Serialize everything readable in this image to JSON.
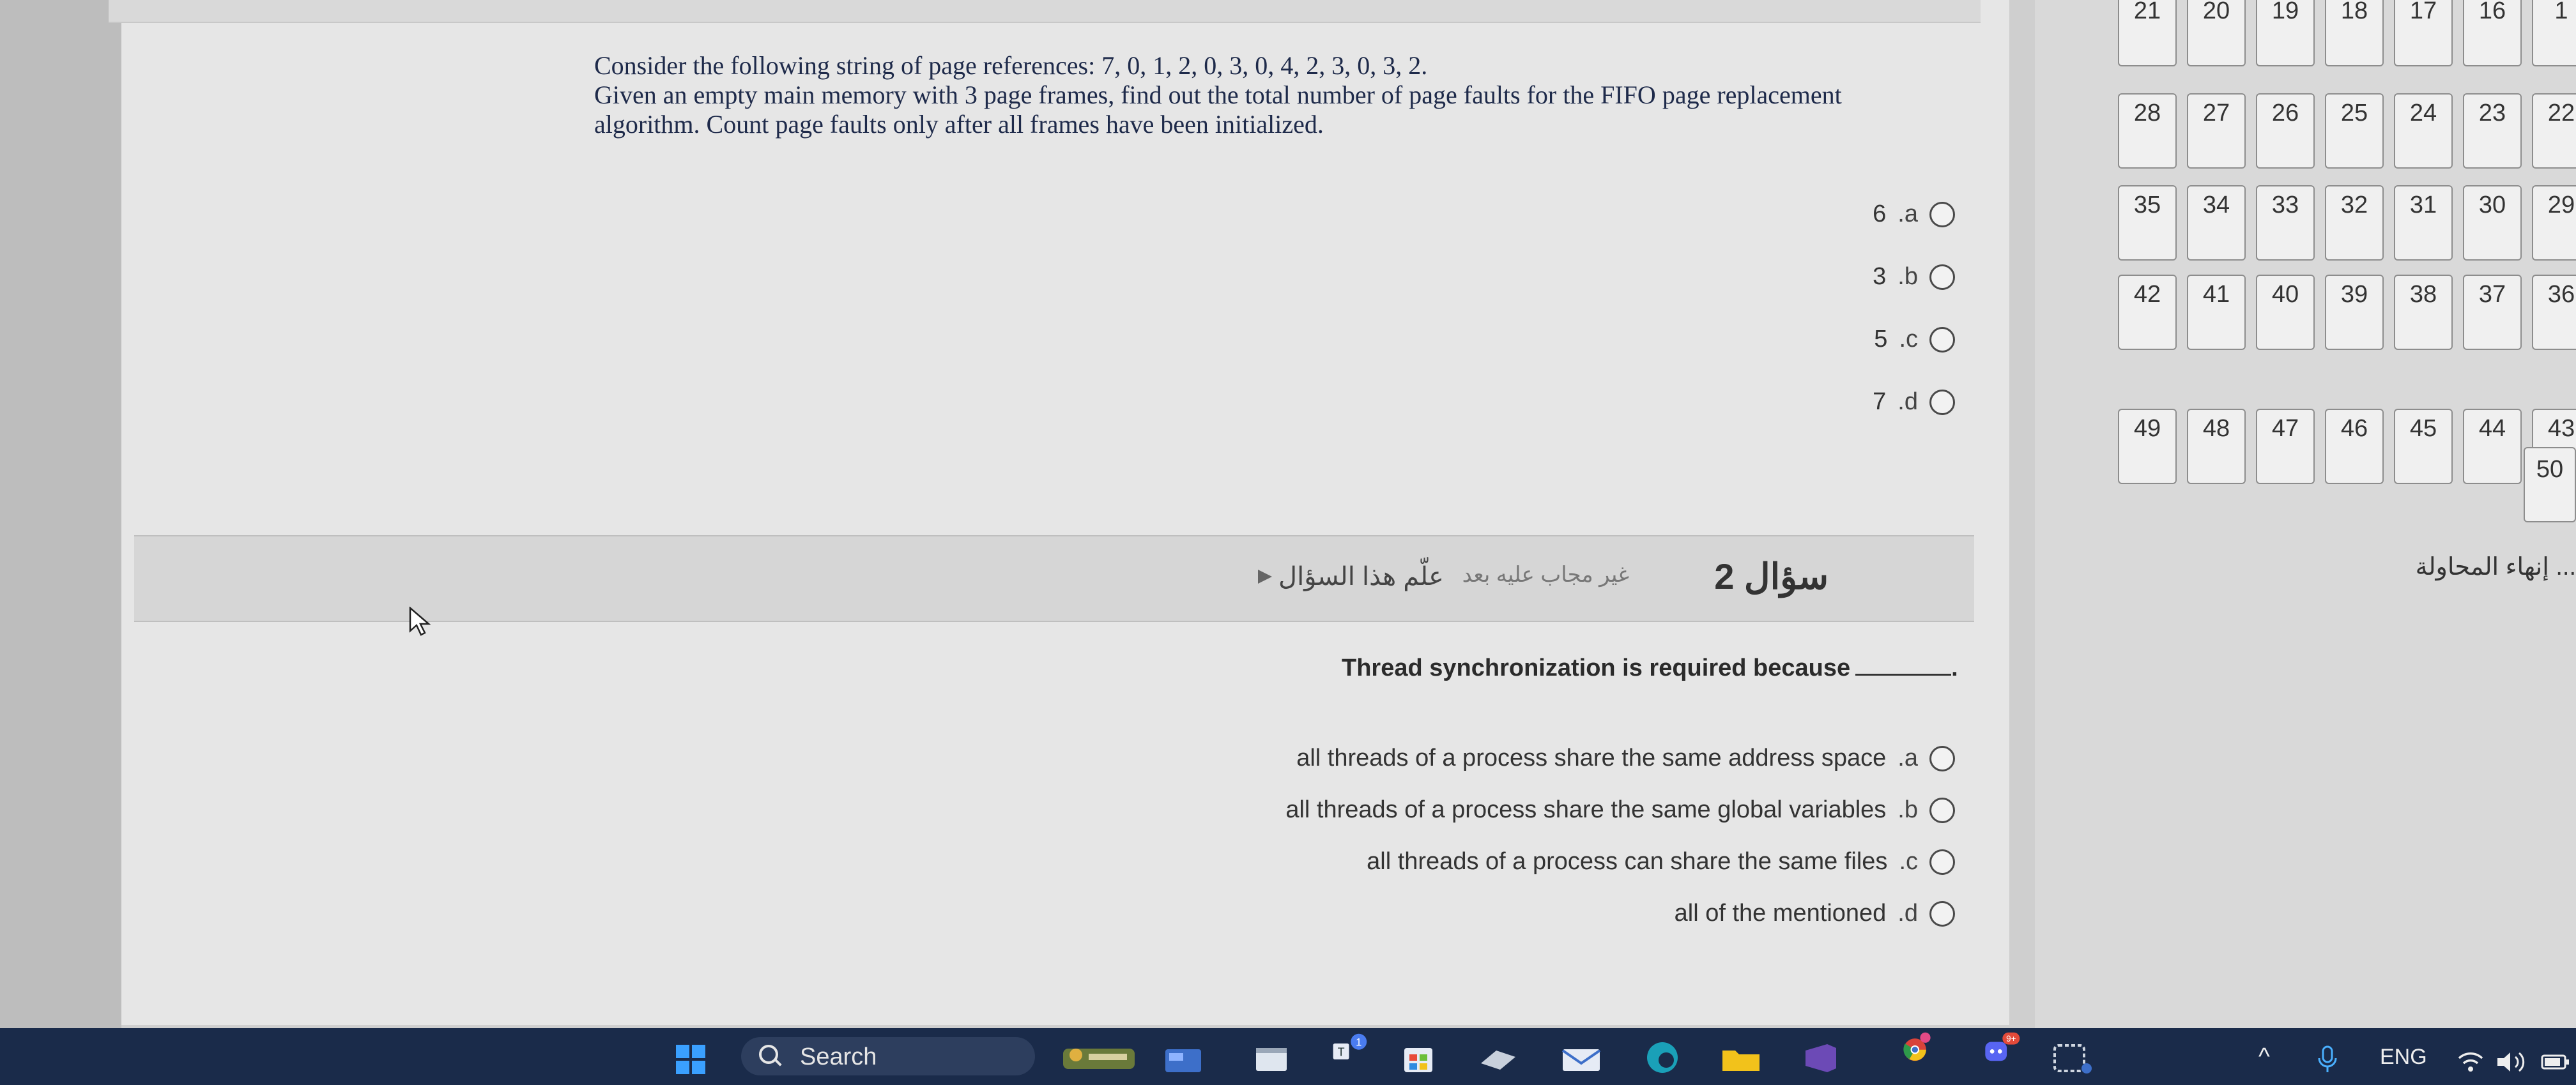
{
  "question1": {
    "text_lines": [
      "Consider the following string of page references: 7, 0, 1, 2, 0, 3, 0, 4, 2, 3, 0, 3, 2.",
      "Given an empty main memory with 3 page frames, find out the total number of page faults for the FIFO page replacement",
      "algorithm. Count page faults only after all frames have been initialized."
    ],
    "options": [
      {
        "letter": ".a",
        "value": "6"
      },
      {
        "letter": ".b",
        "value": "3"
      },
      {
        "letter": ".c",
        "value": "5"
      },
      {
        "letter": ".d",
        "value": "7"
      }
    ]
  },
  "question2": {
    "title": "سؤال 2",
    "status": "غير مجاب عليه بعد",
    "flag_label": "علّم هذا السؤال",
    "text": "Thread synchronization is required because",
    "options": [
      {
        "letter": ".a",
        "text": "all threads of a process share the same address space"
      },
      {
        "letter": ".b",
        "text": "all threads of a process share the same global variables"
      },
      {
        "letter": ".c",
        "text": "all threads of a process can share the same files"
      },
      {
        "letter": ".d",
        "text": "all of the mentioned"
      }
    ]
  },
  "navigation": {
    "rows": [
      [
        "21",
        "20",
        "19",
        "18",
        "17",
        "16",
        "1"
      ],
      [
        "28",
        "27",
        "26",
        "25",
        "24",
        "23",
        "22"
      ],
      [
        "35",
        "34",
        "33",
        "32",
        "31",
        "30",
        "29"
      ],
      [
        "42",
        "41",
        "40",
        "39",
        "38",
        "37",
        "36"
      ],
      [
        "49",
        "48",
        "47",
        "46",
        "45",
        "44",
        "43"
      ],
      [
        "50"
      ]
    ],
    "finish_label": "إنهاء المحاولة ..."
  },
  "taskbar": {
    "search_label": "Search",
    "language": "ENG",
    "notification_badge": "9+",
    "teams_badge": "1"
  },
  "colors": {
    "taskbar": "#1a2b4a",
    "windows_logo": "#3aa0ff",
    "panel": "#e6e6e6",
    "nav_cell_border": "#8d8d8d"
  }
}
